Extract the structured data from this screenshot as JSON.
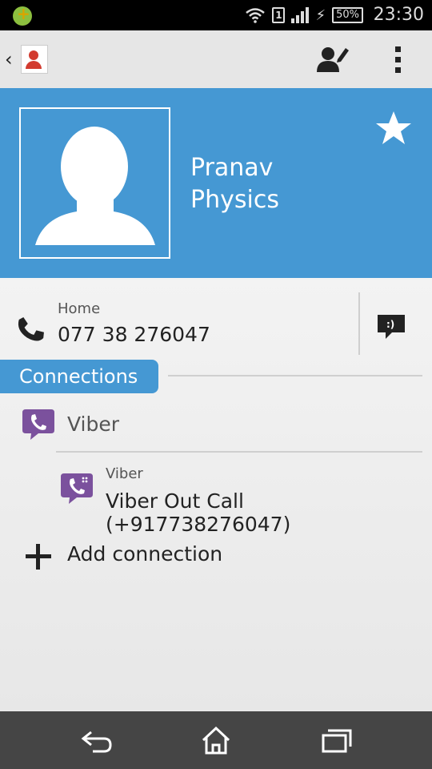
{
  "status_bar": {
    "sim_label": "1",
    "battery": "50%",
    "time": "23:30"
  },
  "action_bar": {
    "back_icon": "chevron-left-icon",
    "app_icon": "contacts-app-icon",
    "edit_icon": "edit-contact-icon",
    "menu_icon": "overflow-menu-icon"
  },
  "contact": {
    "name_first": "Pranav",
    "name_last": "Physics",
    "favorite_icon": "star-icon"
  },
  "phone": {
    "type": "Home",
    "number": "077 38 276047",
    "message_icon_label": ":)"
  },
  "connections": {
    "heading": "Connections",
    "service_name": "Viber",
    "entry_label": "Viber",
    "entry_value": "Viber Out Call (+917738276047)",
    "add_label": "Add connection"
  },
  "colors": {
    "accent": "#4598d3",
    "viber": "#7b519d"
  },
  "navigation": {
    "back": "back-icon",
    "home": "home-icon",
    "recents": "recents-icon"
  }
}
